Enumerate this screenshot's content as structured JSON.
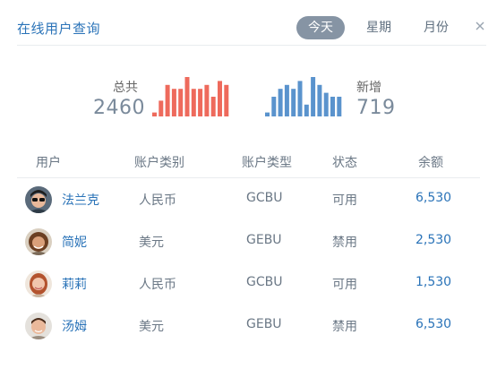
{
  "header": {
    "title": "在线用户查询",
    "tabs": [
      {
        "label": "今天",
        "active": true
      },
      {
        "label": "星期",
        "active": false
      },
      {
        "label": "月份",
        "active": false
      }
    ],
    "close_icon": "close-icon"
  },
  "stats": {
    "total": {
      "label": "总共",
      "value": "2460",
      "color": "#ee6a5c",
      "bars": [
        1,
        4,
        8,
        7,
        7,
        10,
        7,
        7,
        8,
        5,
        9,
        8
      ]
    },
    "new": {
      "label": "新增",
      "value": "719",
      "color": "#5a93cd",
      "bars": [
        1,
        5,
        7,
        8,
        7,
        9,
        3,
        10,
        8,
        6,
        5,
        5
      ]
    }
  },
  "table": {
    "columns": [
      "用户",
      "账户类别",
      "账户类型",
      "状态",
      "余额"
    ],
    "rows": [
      {
        "user": "法兰克",
        "category": "人民币",
        "type": "GCBU",
        "status": "可用",
        "balance": "6,530",
        "avatar": "avatar-sunglasses"
      },
      {
        "user": "简妮",
        "category": "美元",
        "type": "GEBU",
        "status": "禁用",
        "balance": "2,530",
        "avatar": "avatar-curly-hair"
      },
      {
        "user": "莉莉",
        "category": "人民币",
        "type": "GCBU",
        "status": "可用",
        "balance": "1,530",
        "avatar": "avatar-red-hair"
      },
      {
        "user": "汤姆",
        "category": "美元",
        "type": "GEBU",
        "status": "禁用",
        "balance": "6,530",
        "avatar": "avatar-short-hair"
      }
    ]
  }
}
